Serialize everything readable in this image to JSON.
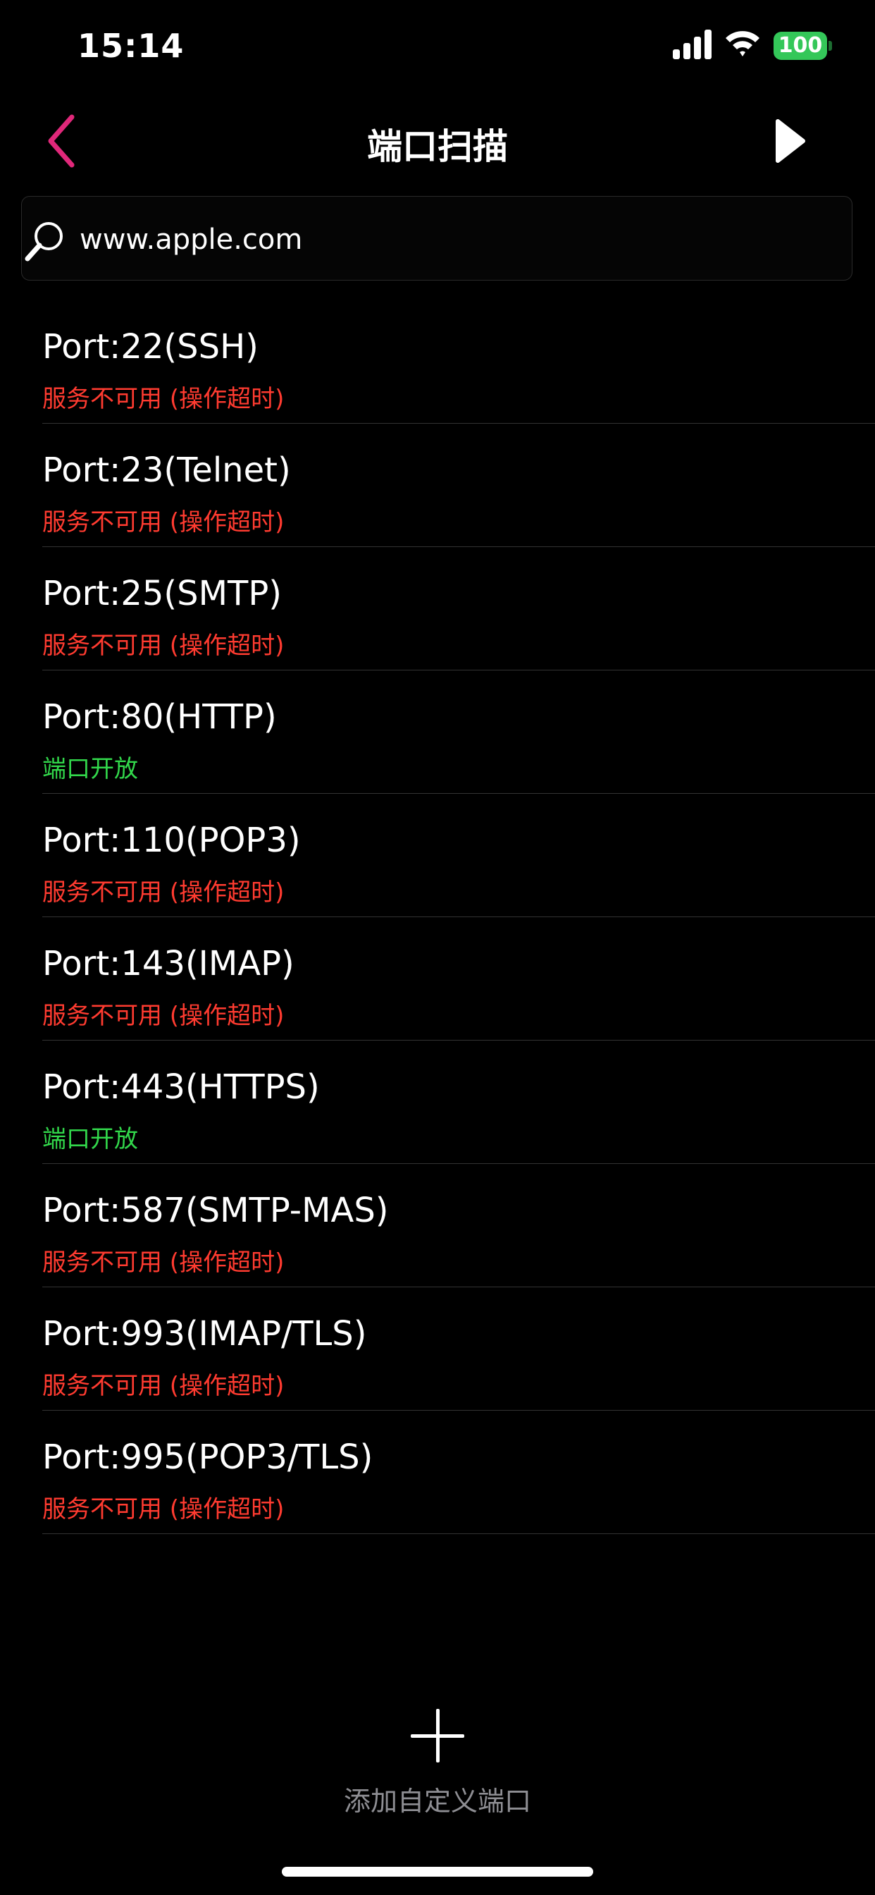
{
  "status_bar": {
    "time": "15:14",
    "battery": "100"
  },
  "nav": {
    "title": "端口扫描"
  },
  "search": {
    "value": "www.apple.com",
    "placeholder": ""
  },
  "colors": {
    "accent": "#e0287a",
    "closed": "#ff3b30",
    "open": "#32d74b",
    "battery": "#34c759"
  },
  "ports": [
    {
      "name": "Port:22(SSH)",
      "status": "服务不可用 (操作超时)",
      "state": "closed"
    },
    {
      "name": "Port:23(Telnet)",
      "status": "服务不可用 (操作超时)",
      "state": "closed"
    },
    {
      "name": "Port:25(SMTP)",
      "status": "服务不可用 (操作超时)",
      "state": "closed"
    },
    {
      "name": "Port:80(HTTP)",
      "status": "端口开放",
      "state": "open"
    },
    {
      "name": "Port:110(POP3)",
      "status": "服务不可用 (操作超时)",
      "state": "closed"
    },
    {
      "name": "Port:143(IMAP)",
      "status": "服务不可用 (操作超时)",
      "state": "closed"
    },
    {
      "name": "Port:443(HTTPS)",
      "status": "端口开放",
      "state": "open"
    },
    {
      "name": "Port:587(SMTP-MAS)",
      "status": "服务不可用 (操作超时)",
      "state": "closed"
    },
    {
      "name": "Port:993(IMAP/TLS)",
      "status": "服务不可用 (操作超时)",
      "state": "closed"
    },
    {
      "name": "Port:995(POP3/TLS)",
      "status": "服务不可用 (操作超时)",
      "state": "closed"
    }
  ],
  "add_port": {
    "label": "添加自定义端口"
  }
}
